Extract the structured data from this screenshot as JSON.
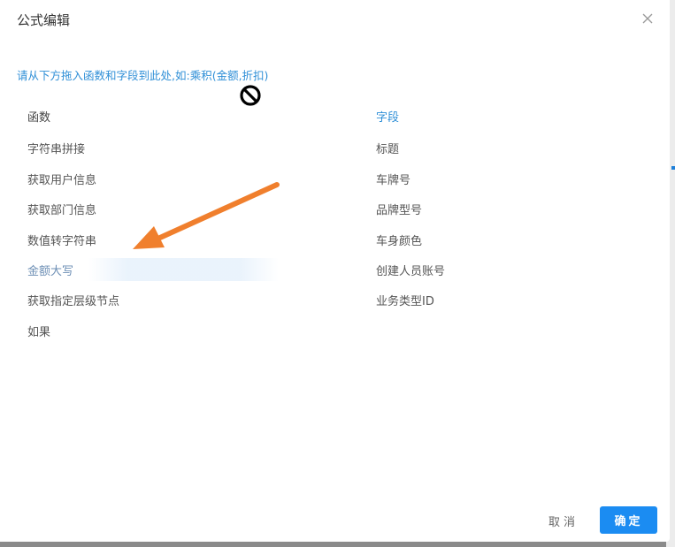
{
  "dialog": {
    "title": "公式编辑",
    "hint": "请从下方拖入函数和字段到此处,如:",
    "hint_example": "乘积(金额,折扣)"
  },
  "functions": {
    "header": "函数",
    "items": [
      {
        "label": "字符串拼接"
      },
      {
        "label": "获取用户信息"
      },
      {
        "label": "获取部门信息"
      },
      {
        "label": "数值转字符串"
      },
      {
        "label": "金额大写"
      },
      {
        "label": "获取指定层级节点"
      },
      {
        "label": "如果"
      }
    ]
  },
  "fields": {
    "header": "字段",
    "items": [
      {
        "label": "标题"
      },
      {
        "label": "车牌号"
      },
      {
        "label": "品牌型号"
      },
      {
        "label": "车身颜色"
      },
      {
        "label": "创建人员账号"
      },
      {
        "label": "业务类型ID"
      }
    ]
  },
  "footer": {
    "cancel_label": "取消",
    "ok_label": "确定"
  },
  "icons": {
    "close": "close-icon",
    "cursor": "no-drop-cursor-icon",
    "annotation": "arrow-annotation"
  },
  "colors": {
    "accent": "#2f8fd7",
    "primary_button": "#1b8cf2",
    "annotation_arrow": "#f07f2d"
  }
}
